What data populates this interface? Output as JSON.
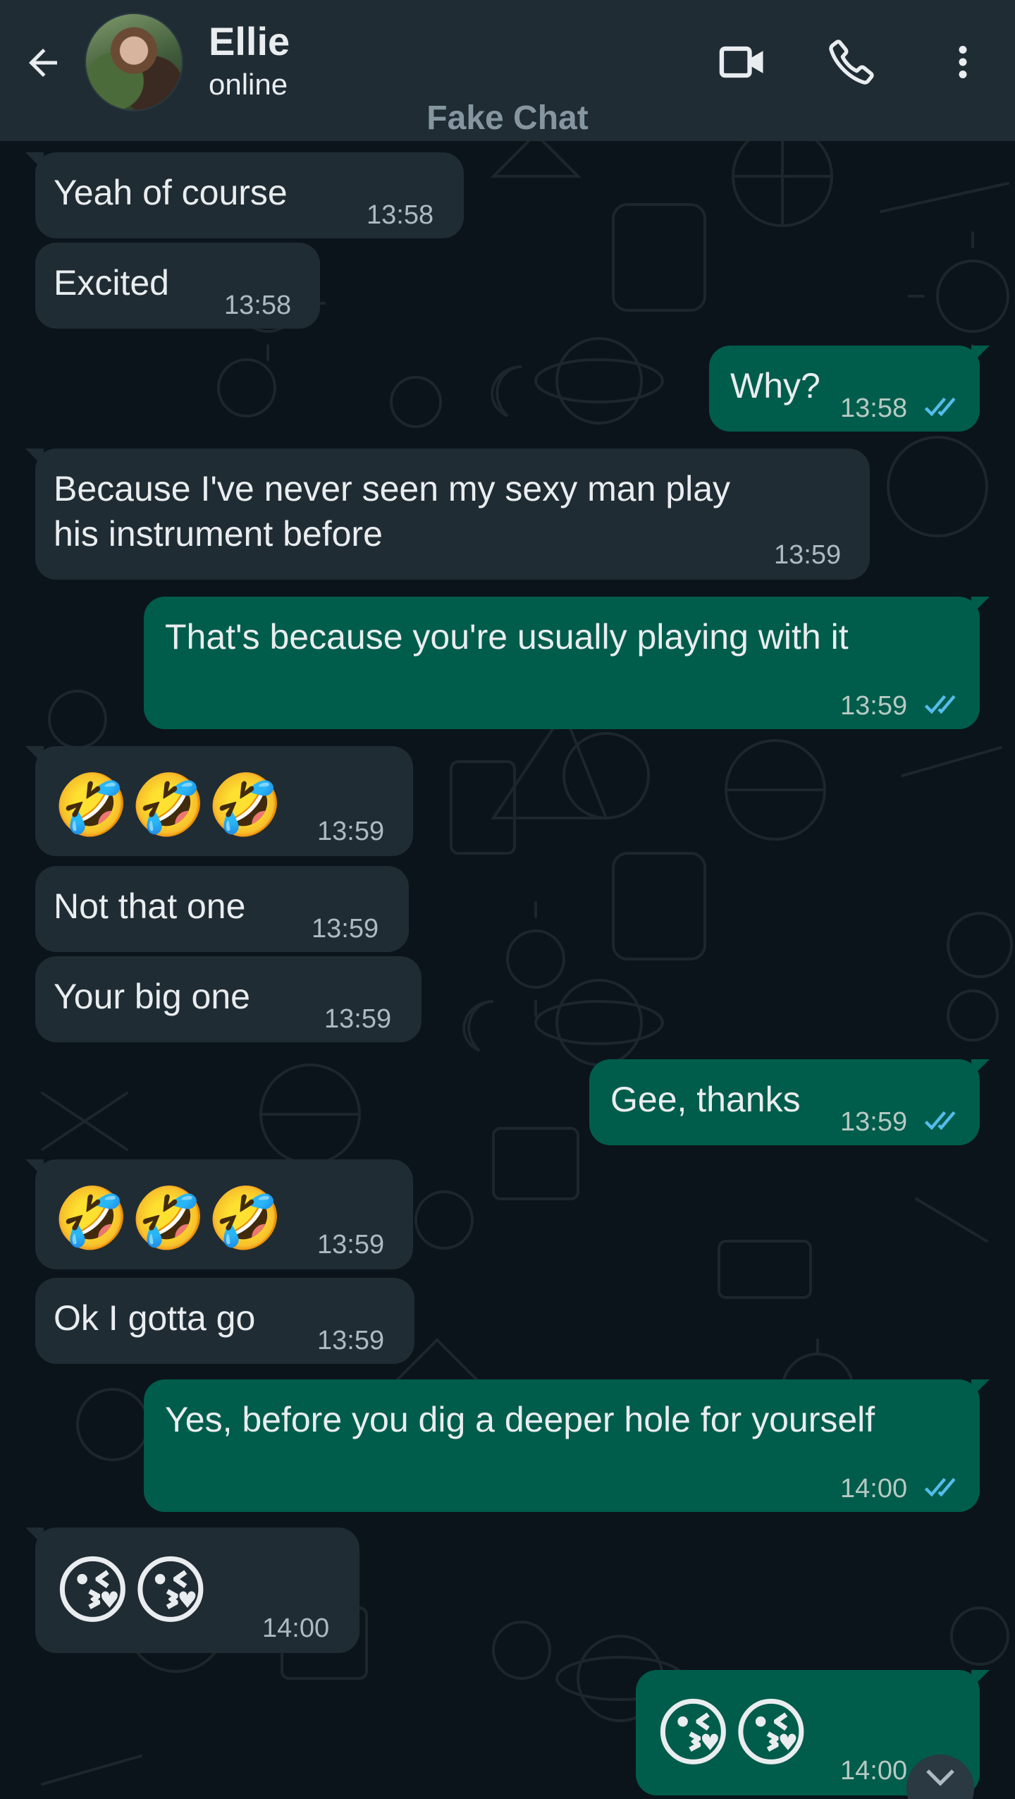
{
  "header": {
    "contact_name": "Ellie",
    "contact_status": "online",
    "watermark": "Fake Chat",
    "icons": [
      "back-arrow-icon",
      "video-call-icon",
      "phone-icon",
      "more-vert-icon"
    ]
  },
  "colors": {
    "header_bg": "#1f2c34",
    "chat_bg": "#0b141a",
    "incoming_bubble": "#202c33",
    "outgoing_bubble": "#005c4b",
    "read_tick": "#53bdeb"
  },
  "messages": [
    {
      "direction": "in",
      "text": "Yeah of course",
      "time": "13:58"
    },
    {
      "direction": "in",
      "text": "Excited",
      "time": "13:58"
    },
    {
      "direction": "out",
      "text": "Why?",
      "time": "13:58",
      "status": "read"
    },
    {
      "direction": "in",
      "text_line1": "Because I've never seen my sexy man play",
      "text_line2": "his instrument before",
      "time": "13:59"
    },
    {
      "direction": "out",
      "text": "That's because you're usually playing with it",
      "time": "13:59",
      "status": "read"
    },
    {
      "direction": "in",
      "text": "🤣🤣🤣",
      "time": "13:59"
    },
    {
      "direction": "in",
      "text": "Not that one",
      "time": "13:59"
    },
    {
      "direction": "in",
      "text": "Your big one",
      "time": "13:59"
    },
    {
      "direction": "out",
      "text": "Gee, thanks",
      "time": "13:59",
      "status": "read"
    },
    {
      "direction": "in",
      "text": "🤣🤣🤣",
      "time": "13:59"
    },
    {
      "direction": "in",
      "text": "Ok I gotta go",
      "time": "13:59"
    },
    {
      "direction": "out",
      "text": "Yes, before you dig a deeper hole for yourself",
      "time": "14:00",
      "status": "read"
    },
    {
      "direction": "in",
      "text": "😘😘",
      "time": "14:00"
    },
    {
      "direction": "out",
      "text": "😘😘",
      "time": "14:00",
      "status": "read"
    }
  ]
}
